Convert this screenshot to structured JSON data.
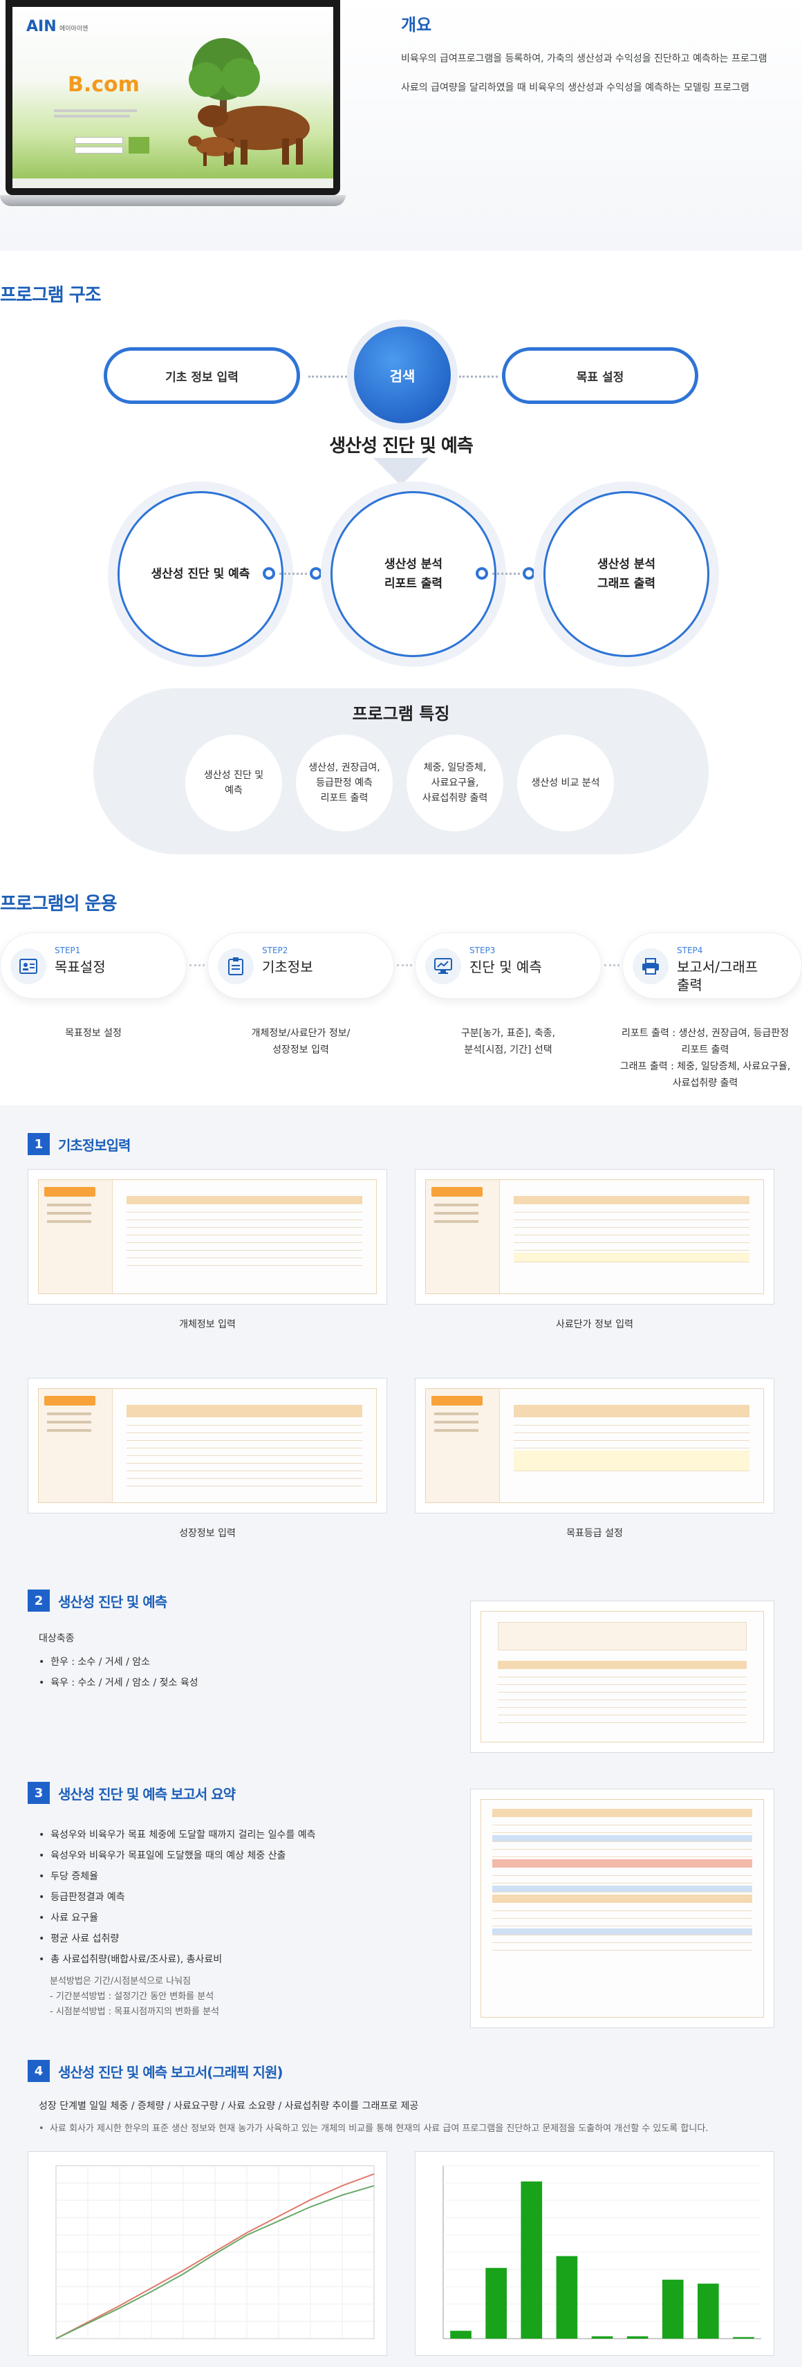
{
  "overview": {
    "title": "개요",
    "paragraphs": [
      "비육우의 급여프로그램을 등록하여, 가축의 생산성과 수익성을 진단하고 예측하는 프로그램",
      "사료의 급여량을 달리하였을 때 비육우의 생산성과 수익성을 예측하는 모델링 프로그램"
    ],
    "screen": {
      "logo": "AIN",
      "logo_sub": "에이아이엔",
      "brand": "B.com"
    }
  },
  "structure": {
    "heading": "프로그램 구조",
    "left_pill": "기초 정보 입력",
    "center": "검색",
    "right_pill": "목표 설정",
    "production_title": "생산성 진단 및 예측",
    "circles": [
      "생산성 진단 및 예측",
      "생산성 분석\n리포트 출력",
      "생산성 분석\n그래프 출력"
    ],
    "features_title": "프로그램 특징",
    "features": [
      "생산성 진단 및\n예측",
      "생산성, 권장급여,\n등급판정 예측\n리포트 출력",
      "체중, 일당증체,\n사료요구율,\n사료섭취량 출력",
      "생산성 비교 분석"
    ]
  },
  "operation": {
    "heading": "프로그램의 운용",
    "steps": [
      {
        "no": "STEP1",
        "name": "목표설정",
        "desc": "목표정보 설정",
        "icon": "id-card-icon"
      },
      {
        "no": "STEP2",
        "name": "기초정보",
        "desc": "개체정보/사료단가 정보/\n성장정보 입력",
        "icon": "clipboard-icon"
      },
      {
        "no": "STEP3",
        "name": "진단 및 예측",
        "desc": "구분[농가, 표준], 축종,\n분석[시점, 기간] 선택",
        "icon": "monitor-icon"
      },
      {
        "no": "STEP4",
        "name": "보고서/그래프\n출력",
        "desc": "리포트 출력 : 생산성, 권장급여, 등급판정\n리포트 출력\n그래프 출력 : 체중, 일당증체, 사료요구율,\n사료섭취량 출력",
        "icon": "printer-icon"
      }
    ]
  },
  "detail": {
    "s1": {
      "no": "1",
      "title": "기초정보입력",
      "captions": [
        "개체정보 입력",
        "사료단가 정보 입력",
        "성장정보 입력",
        "목표등급 설정"
      ]
    },
    "s2": {
      "no": "2",
      "title": "생산성 진단 및 예측",
      "label": "대상축종",
      "items": [
        "한우 : 소수 / 거세 / 암소",
        "육우 : 수소 / 거세 / 암소 / 젖소 육성"
      ]
    },
    "s3": {
      "no": "3",
      "title": "생산성 진단 및 예측 보고서 요약",
      "items": [
        "육성우와 비육우가 목표 체중에 도달할 때까지 걸리는 일수를 예측",
        "육성우와 비육우가 목표일에 도달했을 때의 예상 체중 산출",
        "두당 증체율",
        "등급판정결과 예측",
        "사료 요구율",
        "평균 사료 섭취량",
        "총 사료섭취량(배합사료/조사료), 총사료비"
      ],
      "notes": [
        "분석방법은 기간/시점분석으로 나눠짐",
        "- 기간분석방법 : 설정기간 동안 변화를 분석",
        "- 시점분석방법 : 목표시점까지의 변화를 분석"
      ]
    },
    "s4": {
      "no": "4",
      "title": "생산성 진단 및 예측 보고서(그래픽 지원)",
      "subtitle": "성장 단계별 일일 체중 / 증체량 / 사료요구량 / 사료 소요량 / 사료섭취량 추이를 그래프로 제공",
      "note": "사료 회사가 제시한 한우의 표준 생산 정보와 현재 농가가 사육하고 있는 개체의 비교를 통해 현재의 사료 급여 프로그램을 진단하고 문제점을 도출하여 개선할 수 있도록 합니다."
    }
  },
  "chart_data": [
    {
      "type": "line",
      "x": [
        0,
        1,
        2,
        3,
        4,
        5,
        6,
        7,
        8,
        9,
        10
      ],
      "series": [
        {
          "values": [
            0,
            70,
            140,
            215,
            290,
            370,
            450,
            520,
            590,
            650,
            700
          ]
        },
        {
          "values": [
            0,
            65,
            130,
            200,
            275,
            360,
            440,
            500,
            560,
            610,
            650
          ]
        }
      ],
      "colors": [
        "#e07a6b",
        "#6aa86a"
      ]
    },
    {
      "type": "bar",
      "values": [
        100,
        900,
        2000,
        1050,
        30,
        30,
        750,
        700,
        20
      ],
      "color": "#18a31a"
    }
  ]
}
